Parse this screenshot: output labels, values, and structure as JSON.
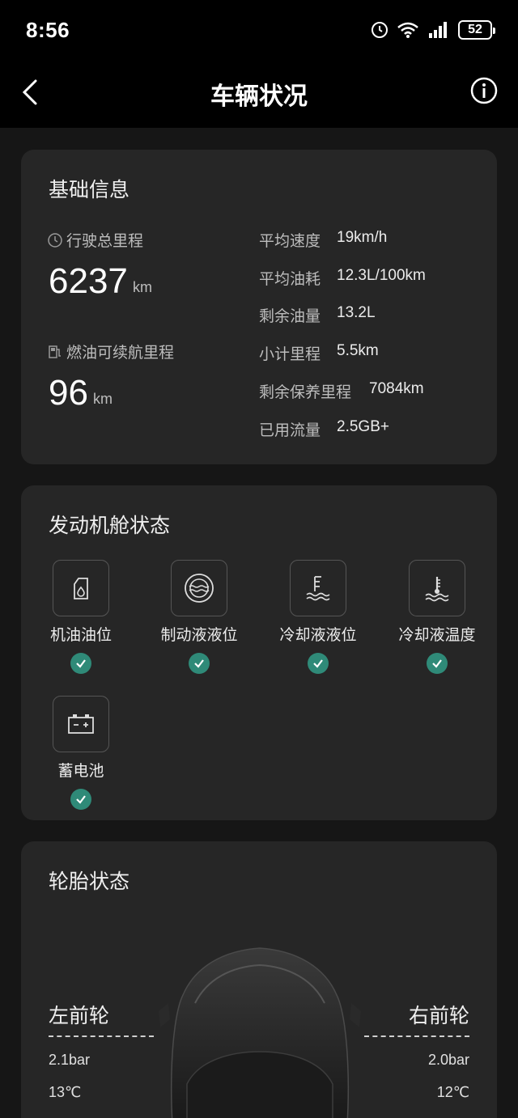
{
  "status_bar": {
    "time": "8:56",
    "battery": "52"
  },
  "nav": {
    "title": "车辆状况"
  },
  "basic": {
    "title": "基础信息",
    "total_mileage_label": "行驶总里程",
    "total_mileage_value": "6237",
    "total_mileage_unit": "km",
    "range_label": "燃油可续航里程",
    "range_value": "96",
    "range_unit": "km",
    "stats": [
      {
        "label": "平均速度",
        "value": "19km/h"
      },
      {
        "label": "平均油耗",
        "value": "12.3L/100km"
      },
      {
        "label": "剩余油量",
        "value": "13.2L"
      },
      {
        "label": "小计里程",
        "value": "5.5km"
      },
      {
        "label": "剩余保养里程",
        "value": "7084km"
      },
      {
        "label": "已用流量",
        "value": "2.5GB+"
      }
    ]
  },
  "engine": {
    "title": "发动机舱状态",
    "items": [
      {
        "label": "机油油位",
        "icon": "oil-level-icon"
      },
      {
        "label": "制动液液位",
        "icon": "brake-fluid-icon"
      },
      {
        "label": "冷却液液位",
        "icon": "coolant-level-icon"
      },
      {
        "label": "冷却液温度",
        "icon": "coolant-temp-icon"
      },
      {
        "label": "蓄电池",
        "icon": "battery-icon"
      }
    ],
    "status_color": "#2f8a78"
  },
  "tires": {
    "title": "轮胎状态",
    "front_left": {
      "label": "左前轮",
      "pressure": "2.1bar",
      "temp": "13℃"
    },
    "front_right": {
      "label": "右前轮",
      "pressure": "2.0bar",
      "temp": "12℃"
    }
  }
}
